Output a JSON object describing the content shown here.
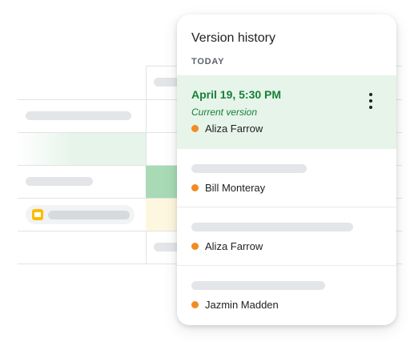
{
  "panel": {
    "title": "Version history",
    "section_label": "TODAY",
    "menu_icon": "more-vert-icon",
    "versions": [
      {
        "date": "April 19, 5:30 PM",
        "subtitle": "Current version",
        "author": "Aliza Farrow"
      },
      {
        "author": "Bill Monteray"
      },
      {
        "author": "Aliza Farrow"
      },
      {
        "author": "Jazmin Madden"
      }
    ]
  },
  "colors": {
    "current_version_bg": "#e6f4ea",
    "current_version_text": "#188038",
    "author_dot": "#f28b22"
  },
  "sheet": {
    "chip_icon": "slides-icon"
  }
}
